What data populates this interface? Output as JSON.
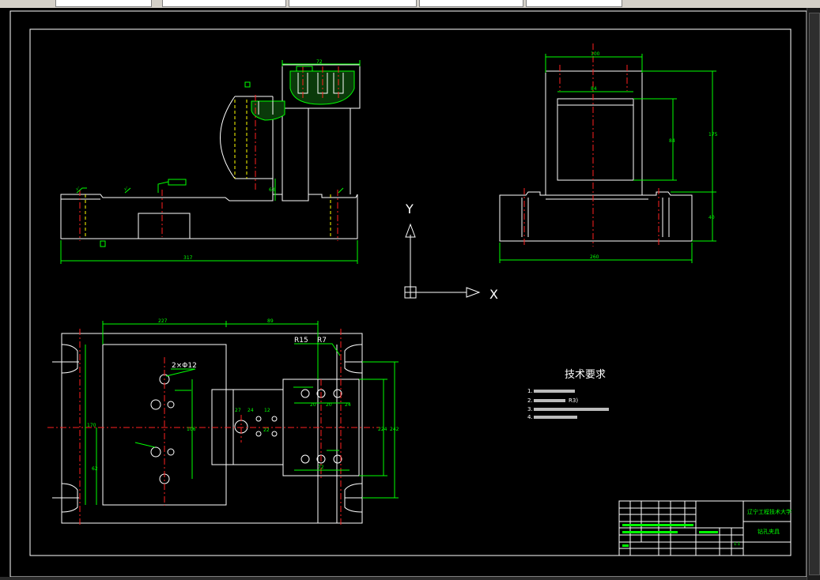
{
  "colors": {
    "background": "#000000",
    "geometry": "#ffffff",
    "dimension": "#00ff00",
    "centerline": "#ff2020",
    "hidden": "#ffff00"
  },
  "ucs": {
    "y_label": "Y",
    "x_label": "X"
  },
  "front_view": {
    "overall_width": "317",
    "top_width": "72",
    "step_height": "63",
    "roughness_1": "√",
    "roughness_2": "√"
  },
  "side_view": {
    "overall_width": "260",
    "top_width": "100",
    "inner_width": "84",
    "inner_height": "84",
    "upper_height": "175",
    "lower_height": "40"
  },
  "plan_view": {
    "dim_left": "227",
    "dim_right": "89",
    "radius_1": "R15",
    "radius_2": "R7",
    "hole_callout": "2×Φ12",
    "dim_vertical_left": "170",
    "dim_vertical_left_2": "62",
    "dim_vertical_right_1": "224",
    "dim_vertical_right_2": "242",
    "dim_small_1": "27",
    "dim_small_2": "24",
    "dim_small_3": "12",
    "dim_small_4": "22",
    "dim_mid": "106",
    "dim_bottom": "72",
    "dim_row_1": "20",
    "dim_row_2": "20",
    "dim_row_3": "24"
  },
  "technical_requirements": {
    "title": "技术要求",
    "items": [
      "1.",
      "2.",
      "3.",
      "4."
    ],
    "item_2_suffix": "R3)"
  },
  "title_block": {
    "school": "辽宁工程技术大学",
    "drawing_name": "钻孔夹具",
    "scale": "1:1"
  }
}
